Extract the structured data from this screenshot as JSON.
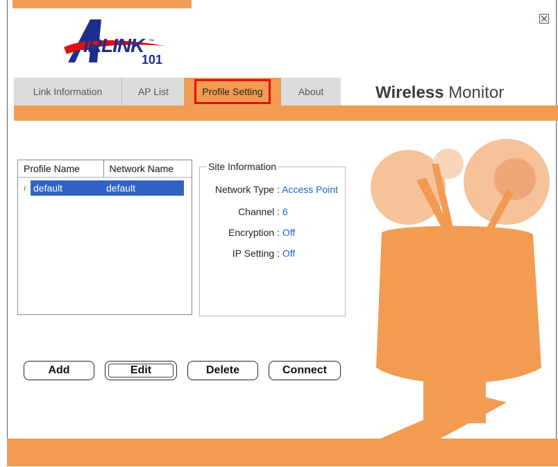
{
  "window": {
    "close_label": "close"
  },
  "logo": {
    "text": "IRLINK",
    "number": "101",
    "tm": "™"
  },
  "tabs": [
    {
      "label": "Link Information",
      "active": false
    },
    {
      "label": "AP List",
      "active": false
    },
    {
      "label": "Profile Setting",
      "active": true
    },
    {
      "label": "About",
      "active": false
    }
  ],
  "title": {
    "bold": "Wireless",
    "normal": "Monitor"
  },
  "profile_list": {
    "columns": [
      "Profile Name",
      "Network Name"
    ],
    "rows": [
      {
        "profile": "default",
        "network": "default"
      }
    ]
  },
  "site_info": {
    "legend": "Site Information",
    "network_type_label": "Network Type :",
    "network_type_value": "Access Point",
    "channel_label": "Channel :",
    "channel_value": "6",
    "encryption_label": "Encryption :",
    "encryption_value": "Off",
    "ip_label": "IP Setting :",
    "ip_value": "Off"
  },
  "buttons": {
    "add": "Add",
    "edit": "Edit",
    "delete": "Delete",
    "connect": "Connect"
  },
  "colors": {
    "accent": "#f29b52",
    "selection": "#3163c6",
    "value": "#1a63c8",
    "highlight": "#e01010"
  }
}
